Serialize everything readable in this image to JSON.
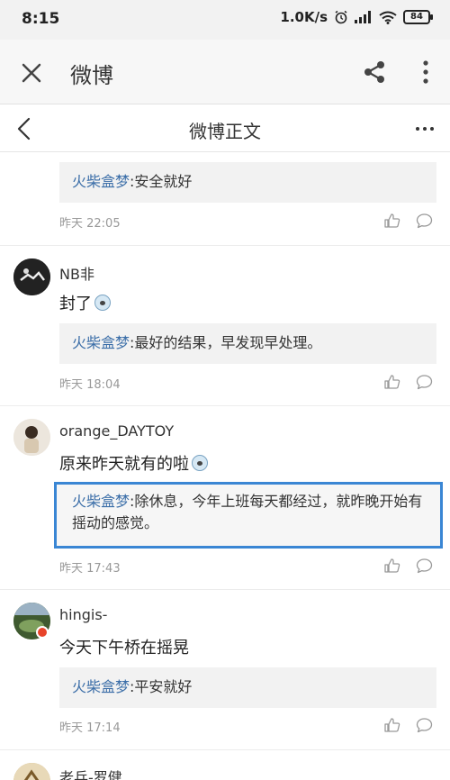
{
  "status_bar": {
    "time": "8:15",
    "network_speed": "1.0K/s",
    "battery": "84"
  },
  "app_bar": {
    "title": "微博",
    "close_icon": "close-icon",
    "share_icon": "share-icon",
    "more_icon": "more-vertical-icon"
  },
  "nav_bar": {
    "title": "微博正文",
    "back_icon": "chevron-left-icon",
    "more_icon": "more-horizontal-icon"
  },
  "comments": [
    {
      "username": "",
      "content": "",
      "reply": {
        "name": "火柴盒梦",
        "text": ":安全就好"
      },
      "time": "昨天 22:05"
    },
    {
      "username": "NB非",
      "content": "封了",
      "reply": {
        "name": "火柴盒梦",
        "text": ":最好的结果，早发现早处理。"
      },
      "time": "昨天 18:04"
    },
    {
      "username": "orange_DAYTOY",
      "content": "原来昨天就有的啦",
      "reply": {
        "name": "火柴盒梦",
        "text": ":除休息，今年上班每天都经过，就昨晚开始有摇动的感觉。"
      },
      "time": "昨天 17:43"
    },
    {
      "username": "hingis-",
      "content": "今天下午桥在摇晃",
      "reply": {
        "name": "火柴盒梦",
        "text": ":平安就好"
      },
      "time": "昨天 17:14"
    },
    {
      "username": "老兵-罗健"
    }
  ],
  "colors": {
    "reply_name": "#3b6ea8",
    "selection_border": "#3a86d4",
    "reply_bg": "#f2f2f2"
  }
}
